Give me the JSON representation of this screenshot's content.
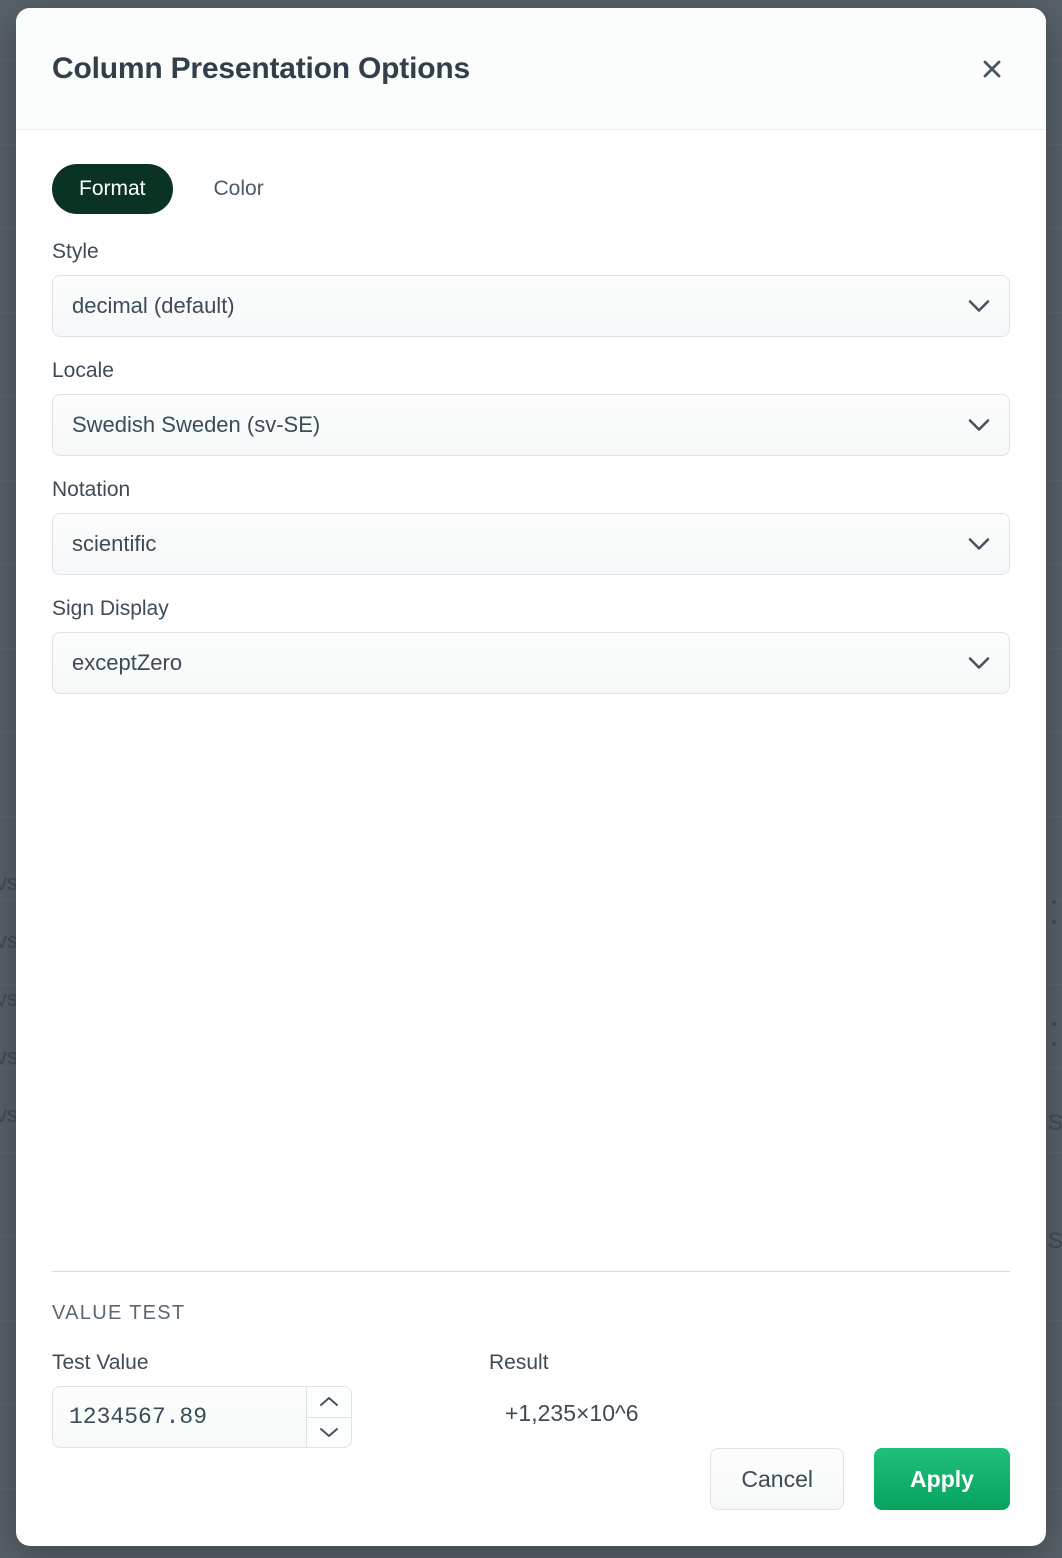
{
  "modal": {
    "title": "Column Presentation Options",
    "close_icon": "close-icon"
  },
  "tabs": [
    {
      "label": "Format",
      "active": true
    },
    {
      "label": "Color",
      "active": false
    }
  ],
  "fields": [
    {
      "label": "Style",
      "value": "decimal (default)",
      "icon": "chevron-down-icon"
    },
    {
      "label": "Locale",
      "value": "Swedish Sweden (sv-SE)",
      "icon": "chevron-down-icon"
    },
    {
      "label": "Notation",
      "value": "scientific",
      "icon": "chevron-down-icon"
    },
    {
      "label": "Sign Display",
      "value": "exceptZero",
      "icon": "chevron-down-icon"
    }
  ],
  "value_test": {
    "section_label": "VALUE TEST",
    "test_value_label": "Test Value",
    "test_value": "1234567.89",
    "result_label": "Result",
    "result_value": "+1,235×10^6",
    "spinner_up_icon": "chevron-up-icon",
    "spinner_down_icon": "chevron-down-icon"
  },
  "footer": {
    "cancel_label": "Cancel",
    "apply_label": "Apply"
  },
  "colors": {
    "overlay": "#586069",
    "tab_active_bg": "#0a3324",
    "apply_bg": "#0fb36d",
    "text": "#3d4a57",
    "border": "#dfe3e8"
  }
}
